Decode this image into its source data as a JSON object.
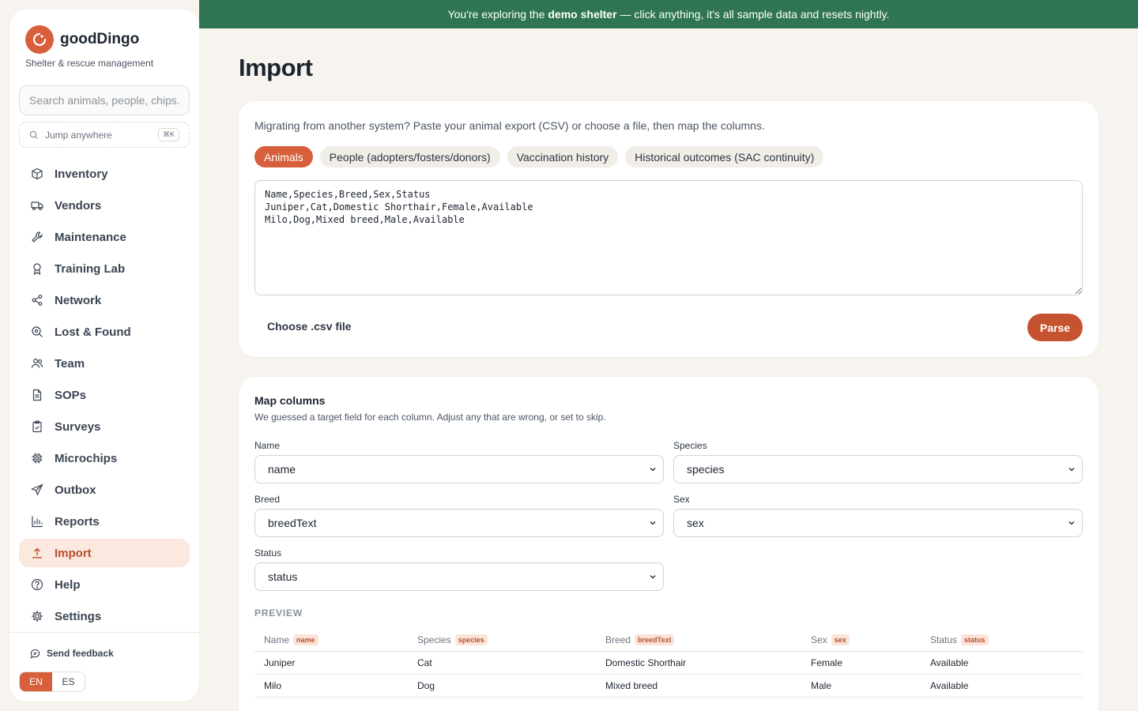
{
  "sidebar": {
    "brand": "goodDingo",
    "tagline": "Shelter & rescue management",
    "search_placeholder": "Search animals, people, chips...",
    "jump_label": "Jump anywhere",
    "jump_shortcut": "⌘K",
    "items": [
      {
        "label": "Inventory",
        "icon": "box-icon"
      },
      {
        "label": "Vendors",
        "icon": "truck-icon"
      },
      {
        "label": "Maintenance",
        "icon": "wrench-icon"
      },
      {
        "label": "Training Lab",
        "icon": "award-icon"
      },
      {
        "label": "Network",
        "icon": "share-icon"
      },
      {
        "label": "Lost & Found",
        "icon": "search-icon"
      },
      {
        "label": "Team",
        "icon": "users-icon"
      },
      {
        "label": "SOPs",
        "icon": "document-icon"
      },
      {
        "label": "Surveys",
        "icon": "clipboard-icon"
      },
      {
        "label": "Microchips",
        "icon": "chip-icon"
      },
      {
        "label": "Outbox",
        "icon": "send-icon"
      },
      {
        "label": "Reports",
        "icon": "bar-chart-icon"
      },
      {
        "label": "Import",
        "icon": "upload-icon"
      },
      {
        "label": "Help",
        "icon": "help-icon"
      },
      {
        "label": "Settings",
        "icon": "gear-icon"
      }
    ],
    "active_item": "Import",
    "feedback_label": "Send feedback",
    "languages": [
      "EN",
      "ES"
    ],
    "active_language": "EN"
  },
  "banner": {
    "prefix": "You're exploring the",
    "bold": "demo shelter",
    "suffix": "— click anything, it's all sample data and resets nightly."
  },
  "page": {
    "title": "Import",
    "intro": "Migrating from another system? Paste your animal export (CSV) or choose a file, then map the columns.",
    "tabs": [
      "Animals",
      "People (adopters/fosters/donors)",
      "Vaccination history",
      "Historical outcomes (SAC continuity)"
    ],
    "active_tab": "Animals",
    "csv_text": "Name,Species,Breed,Sex,Status\nJuniper,Cat,Domestic Shorthair,Female,Available\nMilo,Dog,Mixed breed,Male,Available",
    "choose_file_label": "Choose .csv file",
    "parse_label": "Parse"
  },
  "mapping": {
    "title": "Map columns",
    "subtitle": "We guessed a target field for each column. Adjust any that are wrong, or set to skip.",
    "fields": [
      {
        "label": "Name",
        "value": "name"
      },
      {
        "label": "Species",
        "value": "species"
      },
      {
        "label": "Breed",
        "value": "breedText"
      },
      {
        "label": "Sex",
        "value": "sex"
      },
      {
        "label": "Status",
        "value": "status"
      }
    ],
    "preview_label": "PREVIEW",
    "preview_headers": [
      {
        "label": "Name",
        "tag": "name"
      },
      {
        "label": "Species",
        "tag": "species"
      },
      {
        "label": "Breed",
        "tag": "breedText"
      },
      {
        "label": "Sex",
        "tag": "sex"
      },
      {
        "label": "Status",
        "tag": "status"
      }
    ],
    "preview_rows": [
      [
        "Juniper",
        "Cat",
        "Domestic Shorthair",
        "Female",
        "Available"
      ],
      [
        "Milo",
        "Dog",
        "Mixed breed",
        "Male",
        "Available"
      ]
    ]
  },
  "colors": {
    "accent": "#d85f3c",
    "banner": "#2f7553",
    "background": "#f7f3ee"
  }
}
